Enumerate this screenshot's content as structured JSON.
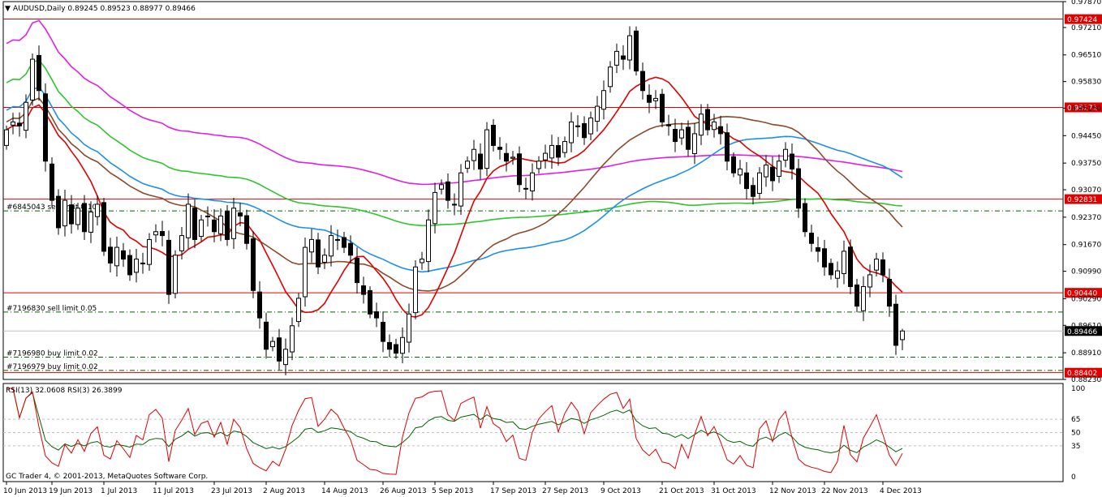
{
  "header": {
    "symbol_line": "AUDUSD,Daily  0.89245 0.89523 0.88977 0.89466",
    "rsi_line": "RSI(13) 32.0608  RSI(3) 26.3899",
    "copyright": "GC Trader 4, © 2001-2013, MetaQuotes Software Corp."
  },
  "colors": {
    "background": "#ffffff",
    "bull_candle": "#ffffff",
    "bear_candle": "#000000",
    "level_line": "#e00000",
    "order_line": "#006400",
    "ma_red": "#e00000",
    "ma_brown": "#8b4a2b",
    "ma_blue": "#1e8fe8",
    "ma_green": "#2ec52e",
    "ma_magenta": "#e020e0",
    "rsi13": "#006400",
    "rsi3": "#e00000"
  },
  "chart_data": [
    {
      "type": "candlestick",
      "title": "AUDUSD,Daily",
      "ohlc_header": [
        0.89245,
        0.89523,
        0.88977,
        0.89466
      ],
      "ylim": [
        0.8823,
        0.9787
      ],
      "yticks": [
        "0.97870",
        "0.97210",
        "0.96510",
        "0.95830",
        "0.95150",
        "0.94450",
        "0.93750",
        "0.93070",
        "0.92370",
        "0.91670",
        "0.90990",
        "0.90290",
        "0.89610",
        "0.88910",
        "0.88230"
      ],
      "xticks": [
        "10 Jun 2013",
        "19 Jun 2013",
        "1 Jul 2013",
        "11 Jul 2013",
        "23 Jul 2013",
        "2 Aug 2013",
        "14 Aug 2013",
        "26 Aug 2013",
        "5 Sep 2013",
        "17 Sep 2013",
        "27 Sep 2013",
        "9 Oct 2013",
        "21 Oct 2013",
        "31 Oct 2013",
        "12 Nov 2013",
        "22 Nov 2013",
        "4 Dec 2013"
      ],
      "xtick_index": [
        0,
        7,
        15,
        23,
        32,
        40,
        49,
        58,
        66,
        75,
        83,
        92,
        101,
        109,
        118,
        126,
        135
      ],
      "current_price": "0.89466",
      "levels": [
        {
          "price": 0.97424,
          "label": "0.97424"
        },
        {
          "price": 0.95171,
          "label": "0.95171"
        },
        {
          "price": 0.92831,
          "label": "0.92831"
        },
        {
          "price": 0.9044,
          "label": "0.90440"
        },
        {
          "price": 0.88402,
          "label": "0.88402"
        }
      ],
      "orders": [
        {
          "price": 0.9253,
          "label": "#6845043 sell limit 0.10"
        },
        {
          "price": 0.8995,
          "label": "#7196830 sell limit 0.05"
        },
        {
          "price": 0.888,
          "label": "#7196980 buy limit 0.02"
        },
        {
          "price": 0.8846,
          "label": "#7196979 buy limit 0.02"
        }
      ],
      "close": [
        0.946,
        0.948,
        0.947,
        0.953,
        0.964,
        0.956,
        0.938,
        0.928,
        0.921,
        0.928,
        0.922,
        0.926,
        0.92,
        0.925,
        0.927,
        0.915,
        0.912,
        0.916,
        0.913,
        0.909,
        0.913,
        0.912,
        0.918,
        0.92,
        0.919,
        0.904,
        0.914,
        0.919,
        0.927,
        0.918,
        0.923,
        0.924,
        0.92,
        0.924,
        0.918,
        0.926,
        0.924,
        0.917,
        0.905,
        0.898,
        0.89,
        0.892,
        0.887,
        0.89,
        0.896,
        0.903,
        0.916,
        0.918,
        0.911,
        0.914,
        0.919,
        0.918,
        0.916,
        0.914,
        0.907,
        0.904,
        0.899,
        0.898,
        0.892,
        0.89,
        0.889,
        0.893,
        0.899,
        0.911,
        0.913,
        0.923,
        0.93,
        0.932,
        0.928,
        0.927,
        0.935,
        0.938,
        0.941,
        0.936,
        0.946,
        0.942,
        0.941,
        0.938,
        0.939,
        0.932,
        0.931,
        0.935,
        0.938,
        0.94,
        0.942,
        0.939,
        0.943,
        0.948,
        0.947,
        0.944,
        0.949,
        0.952,
        0.956,
        0.962,
        0.966,
        0.964,
        0.97,
        0.961,
        0.956,
        0.953,
        0.954,
        0.948,
        0.947,
        0.943,
        0.946,
        0.941,
        0.945,
        0.95,
        0.946,
        0.948,
        0.945,
        0.938,
        0.935,
        0.936,
        0.931,
        0.929,
        0.935,
        0.937,
        0.933,
        0.938,
        0.941,
        0.936,
        0.926,
        0.92,
        0.917,
        0.915,
        0.911,
        0.909,
        0.91,
        0.915,
        0.906,
        0.901,
        0.906,
        0.909,
        0.913,
        0.909,
        0.901,
        0.891,
        0.8947
      ]
    },
    {
      "type": "line",
      "title": "RSI(13) 32.0608 RSI(3) 26.3899",
      "ylim": [
        0,
        100
      ],
      "yticks": [
        "100",
        "65",
        "50",
        "35",
        "0"
      ],
      "series": [
        {
          "name": "RSI(13)",
          "last": 32.0608
        },
        {
          "name": "RSI(3)",
          "last": 26.3899
        }
      ]
    }
  ]
}
